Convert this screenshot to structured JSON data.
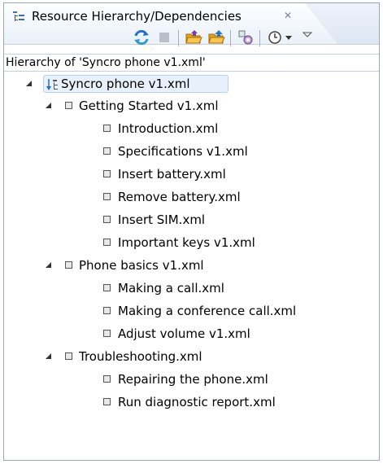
{
  "tab": {
    "title": "Resource Hierarchy/Dependencies",
    "close_glyph": "✕"
  },
  "toolbar": {
    "icons": [
      "refresh-icon",
      "stop-icon",
      "open-folder-icon",
      "open-folder-up-icon",
      "configure-icon",
      "history-icon",
      "view-menu-icon"
    ]
  },
  "header": {
    "text": "Hierarchy of 'Syncro phone v1.xml'"
  },
  "tree": {
    "root": "Syncro phone v1.xml",
    "groups": [
      {
        "label": "Getting Started v1.xml",
        "children": [
          "Introduction.xml",
          "Specifications v1.xml",
          "Insert battery.xml",
          "Remove battery.xml",
          "Insert SIM.xml",
          "Important keys v1.xml"
        ]
      },
      {
        "label": "Phone basics v1.xml",
        "children": [
          "Making a call.xml",
          "Making a conference call.xml",
          "Adjust volume v1.xml"
        ]
      },
      {
        "label": "Troubleshooting.xml",
        "children": [
          "Repairing the phone.xml",
          "Run diagnostic report.xml"
        ]
      }
    ]
  }
}
